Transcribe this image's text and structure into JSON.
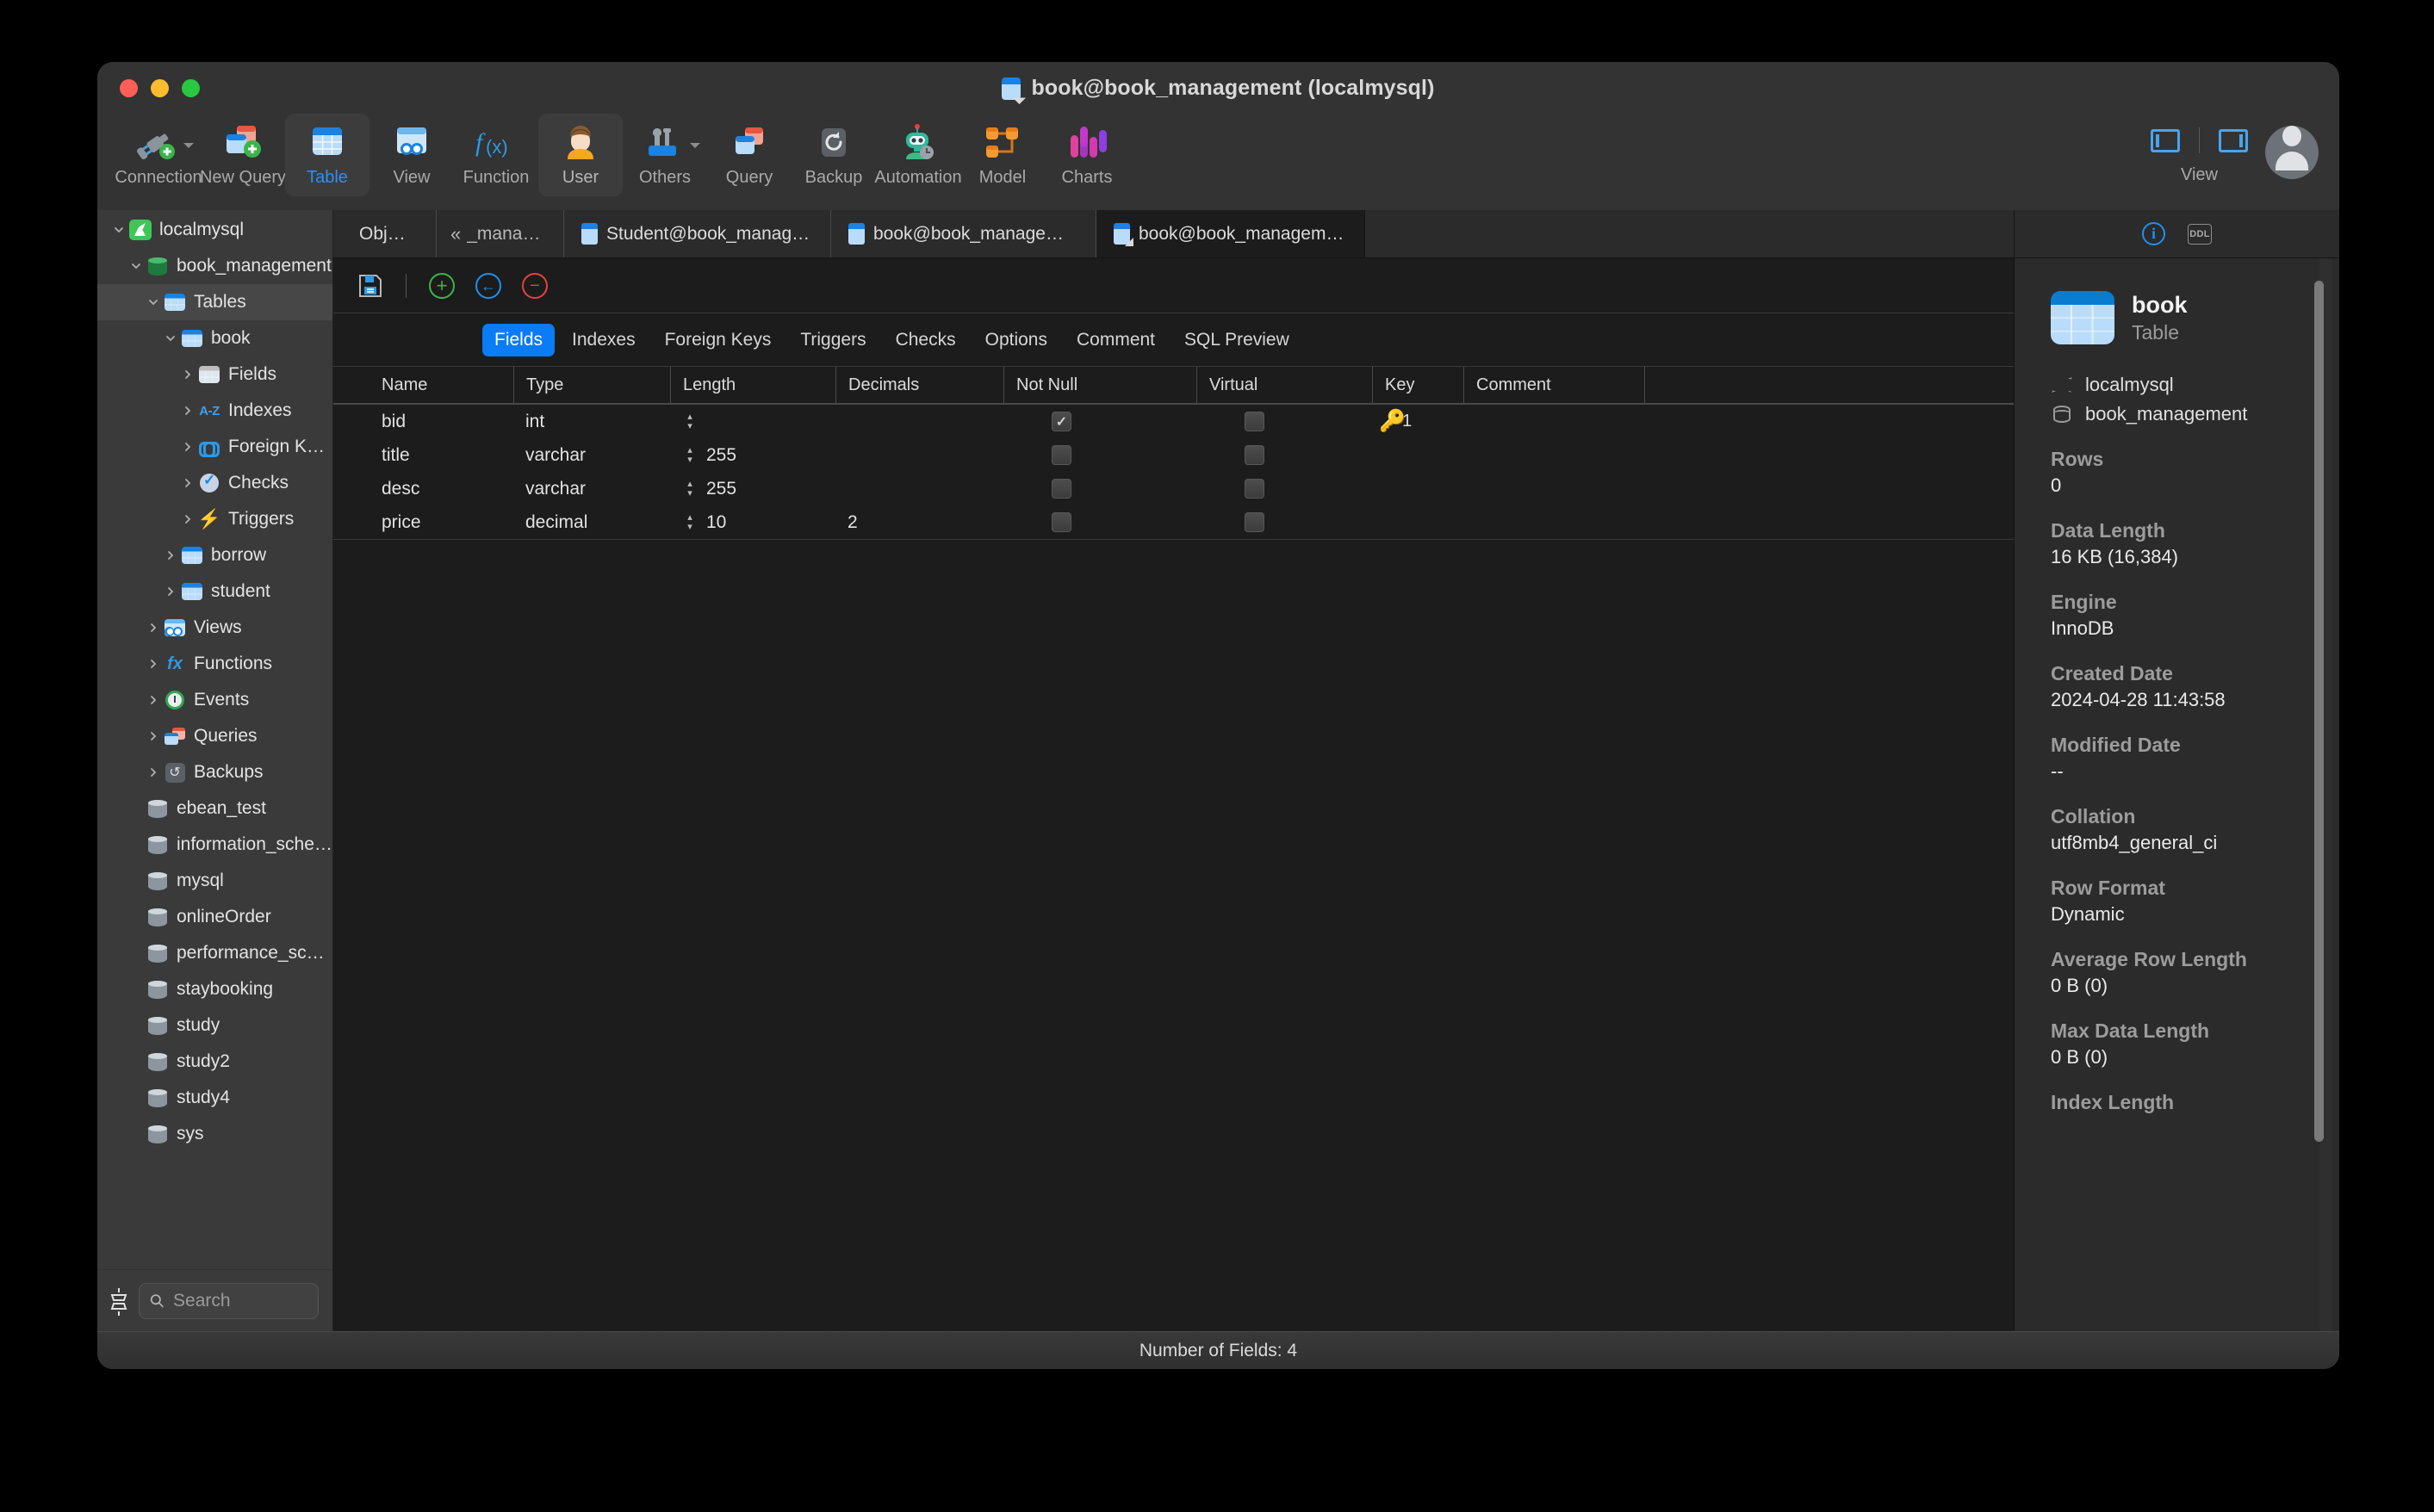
{
  "window": {
    "title": "book@book_management (localmysql)",
    "traffic_lights": [
      "close",
      "minimize",
      "maximize"
    ]
  },
  "toolbar": {
    "items": [
      {
        "label": "Connection",
        "icon": "connection-add-icon",
        "has_caret": true,
        "active": false
      },
      {
        "label": "New Query",
        "icon": "new-query-icon",
        "has_caret": false,
        "active": false
      },
      {
        "label": "Table",
        "icon": "table-icon",
        "has_caret": false,
        "active": true
      },
      {
        "label": "View",
        "icon": "view-icon",
        "has_caret": false,
        "active": false
      },
      {
        "label": "Function",
        "icon": "function-fx-icon",
        "has_caret": false,
        "active": false
      },
      {
        "label": "User",
        "icon": "user-icon",
        "has_caret": false,
        "active": true
      },
      {
        "label": "Others",
        "icon": "others-tools-icon",
        "has_caret": true,
        "active": false
      },
      {
        "label": "Query",
        "icon": "query-icon",
        "has_caret": false,
        "active": false
      },
      {
        "label": "Backup",
        "icon": "backup-icon",
        "has_caret": false,
        "active": false
      },
      {
        "label": "Automation",
        "icon": "automation-robot-icon",
        "has_caret": false,
        "active": false
      },
      {
        "label": "Model",
        "icon": "model-icon",
        "has_caret": false,
        "active": false
      },
      {
        "label": "Charts",
        "icon": "charts-icon",
        "has_caret": false,
        "active": false
      }
    ],
    "view_group_label": "View"
  },
  "sidebar": {
    "tree": [
      {
        "label": "localmysql",
        "indent": 0,
        "twisty": "down",
        "icon": "mysql-dolphin-icon",
        "selected": false
      },
      {
        "label": "book_management",
        "indent": 1,
        "twisty": "down",
        "icon": "database-icon",
        "selected": false
      },
      {
        "label": "Tables",
        "indent": 2,
        "twisty": "down",
        "icon": "tables-icon",
        "selected": true
      },
      {
        "label": "book",
        "indent": 3,
        "twisty": "down",
        "icon": "table-icon",
        "selected": false
      },
      {
        "label": "Fields",
        "indent": 4,
        "twisty": "right",
        "icon": "fields-icon",
        "selected": false
      },
      {
        "label": "Indexes",
        "indent": 4,
        "twisty": "right",
        "icon": "indexes-az-icon",
        "selected": false
      },
      {
        "label": "Foreign Keys",
        "indent": 4,
        "twisty": "right",
        "icon": "foreign-keys-icon",
        "selected": false
      },
      {
        "label": "Checks",
        "indent": 4,
        "twisty": "right",
        "icon": "checks-icon",
        "selected": false
      },
      {
        "label": "Triggers",
        "indent": 4,
        "twisty": "right",
        "icon": "triggers-bolt-icon",
        "selected": false
      },
      {
        "label": "borrow",
        "indent": 3,
        "twisty": "right",
        "icon": "table-icon",
        "selected": false
      },
      {
        "label": "student",
        "indent": 3,
        "twisty": "right",
        "icon": "table-icon",
        "selected": false
      },
      {
        "label": "Views",
        "indent": 2,
        "twisty": "right",
        "icon": "views-icon",
        "selected": false
      },
      {
        "label": "Functions",
        "indent": 2,
        "twisty": "right",
        "icon": "functions-fx-icon",
        "selected": false
      },
      {
        "label": "Events",
        "indent": 2,
        "twisty": "right",
        "icon": "events-clock-icon",
        "selected": false
      },
      {
        "label": "Queries",
        "indent": 2,
        "twisty": "right",
        "icon": "queries-icon",
        "selected": false
      },
      {
        "label": "Backups",
        "indent": 2,
        "twisty": "right",
        "icon": "backups-icon",
        "selected": false
      },
      {
        "label": "ebean_test",
        "indent": 1,
        "twisty": "none",
        "icon": "database-grey-icon",
        "selected": false
      },
      {
        "label": "information_schema",
        "indent": 1,
        "twisty": "none",
        "icon": "database-grey-icon",
        "selected": false
      },
      {
        "label": "mysql",
        "indent": 1,
        "twisty": "none",
        "icon": "database-grey-icon",
        "selected": false
      },
      {
        "label": "onlineOrder",
        "indent": 1,
        "twisty": "none",
        "icon": "database-grey-icon",
        "selected": false
      },
      {
        "label": "performance_schema",
        "indent": 1,
        "twisty": "none",
        "icon": "database-grey-icon",
        "selected": false
      },
      {
        "label": "staybooking",
        "indent": 1,
        "twisty": "none",
        "icon": "database-grey-icon",
        "selected": false
      },
      {
        "label": "study",
        "indent": 1,
        "twisty": "none",
        "icon": "database-grey-icon",
        "selected": false
      },
      {
        "label": "study2",
        "indent": 1,
        "twisty": "none",
        "icon": "database-grey-icon",
        "selected": false
      },
      {
        "label": "study4",
        "indent": 1,
        "twisty": "none",
        "icon": "database-grey-icon",
        "selected": false
      },
      {
        "label": "sys",
        "indent": 1,
        "twisty": "none",
        "icon": "database-grey-icon",
        "selected": false
      }
    ],
    "search_placeholder": "Search",
    "search_value": ""
  },
  "tabs": [
    {
      "label": "Objects",
      "icon": "none",
      "active": false
    },
    {
      "label": "_manage...",
      "icon": "collapse",
      "active": false
    },
    {
      "label": "Student@book_manage...",
      "icon": "table-icon",
      "active": false
    },
    {
      "label": "book@book_manageme...",
      "icon": "table-icon",
      "active": false
    },
    {
      "label": "book@book_manageme...",
      "icon": "table-design-icon",
      "active": true
    }
  ],
  "grid_toolbar": [
    {
      "name": "save-button",
      "icon": "floppy-disk-icon"
    },
    {
      "name": "add-field-button",
      "icon": "plus-circle-icon",
      "glyph": "+"
    },
    {
      "name": "insert-field-button",
      "icon": "arrow-left-circle-icon",
      "glyph": "←"
    },
    {
      "name": "delete-field-button",
      "icon": "minus-circle-icon",
      "glyph": "−"
    }
  ],
  "subtabs": [
    {
      "label": "Fields",
      "active": true
    },
    {
      "label": "Indexes",
      "active": false
    },
    {
      "label": "Foreign Keys",
      "active": false
    },
    {
      "label": "Triggers",
      "active": false
    },
    {
      "label": "Checks",
      "active": false
    },
    {
      "label": "Options",
      "active": false
    },
    {
      "label": "Comment",
      "active": false
    },
    {
      "label": "SQL Preview",
      "active": false
    }
  ],
  "fields_grid": {
    "columns": [
      "Name",
      "Type",
      "Length",
      "Decimals",
      "Not Null",
      "Virtual",
      "Key",
      "Comment"
    ],
    "rows": [
      {
        "name": "bid",
        "type": "int",
        "length": "",
        "decimals": "",
        "not_null": true,
        "virtual": false,
        "key": "1",
        "comment": ""
      },
      {
        "name": "title",
        "type": "varchar",
        "length": "255",
        "decimals": "",
        "not_null": false,
        "virtual": false,
        "key": "",
        "comment": ""
      },
      {
        "name": "desc",
        "type": "varchar",
        "length": "255",
        "decimals": "",
        "not_null": false,
        "virtual": false,
        "key": "",
        "comment": ""
      },
      {
        "name": "price",
        "type": "decimal",
        "length": "10",
        "decimals": "2",
        "not_null": false,
        "virtual": false,
        "key": "",
        "comment": ""
      }
    ]
  },
  "info_panel": {
    "header_icons": [
      "info-icon",
      "ddl-icon"
    ],
    "object_name": "book",
    "object_kind": "Table",
    "connection": "localmysql",
    "database": "book_management",
    "fields": [
      {
        "label": "Rows",
        "value": "0"
      },
      {
        "label": "Data Length",
        "value": "16 KB (16,384)"
      },
      {
        "label": "Engine",
        "value": "InnoDB"
      },
      {
        "label": "Created Date",
        "value": "2024-04-28 11:43:58"
      },
      {
        "label": "Modified Date",
        "value": "--"
      },
      {
        "label": "Collation",
        "value": "utf8mb4_general_ci"
      },
      {
        "label": "Row Format",
        "value": "Dynamic"
      },
      {
        "label": "Average Row Length",
        "value": "0 B (0)"
      },
      {
        "label": "Max Data Length",
        "value": "0 B (0)"
      },
      {
        "label": "Index Length",
        "value": ""
      }
    ]
  },
  "statusbar": {
    "text": "Number of Fields: 4"
  },
  "colors": {
    "accent": "#0a7cf6",
    "window_bg": "#2b2b2b",
    "sidebar_bg": "#3a3a3a",
    "main_bg": "#1c1c1c",
    "key_orange": "#f5a623"
  }
}
